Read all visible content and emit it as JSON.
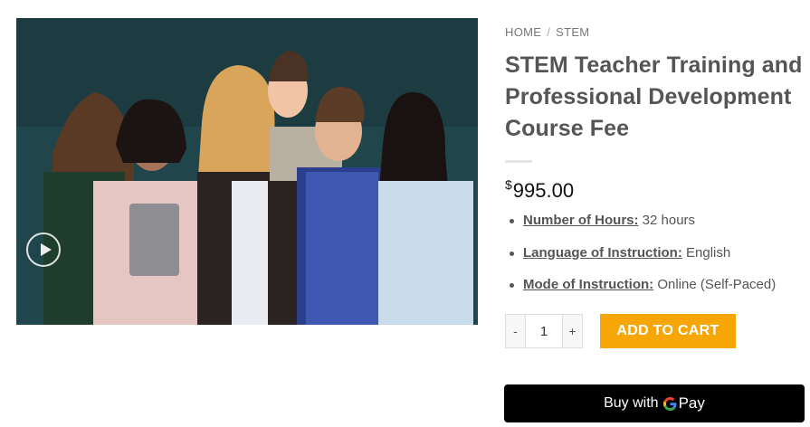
{
  "breadcrumb": {
    "home": "HOME",
    "separator": "/",
    "category": "STEM"
  },
  "product": {
    "title": "STEM Teacher Training and Professional Development Course Fee",
    "currency_symbol": "$",
    "price": "995.00",
    "attributes": [
      {
        "label": "Number of Hours:",
        "value": "32 hours"
      },
      {
        "label": "Language of Instruction:",
        "value": "English"
      },
      {
        "label": "Mode of Instruction:",
        "value": "Online (Self-Paced)"
      }
    ],
    "image_alt": "Group of smiling teachers",
    "play_icon": "play-icon"
  },
  "cart": {
    "minus_label": "-",
    "plus_label": "+",
    "quantity": "1",
    "add_label": "ADD TO CART"
  },
  "gpay": {
    "label": "Buy with",
    "pay_word": "Pay"
  },
  "colors": {
    "accent": "#f6a707",
    "title": "#555555",
    "gpay_bg": "#000000",
    "image_bg": "#20454a"
  }
}
